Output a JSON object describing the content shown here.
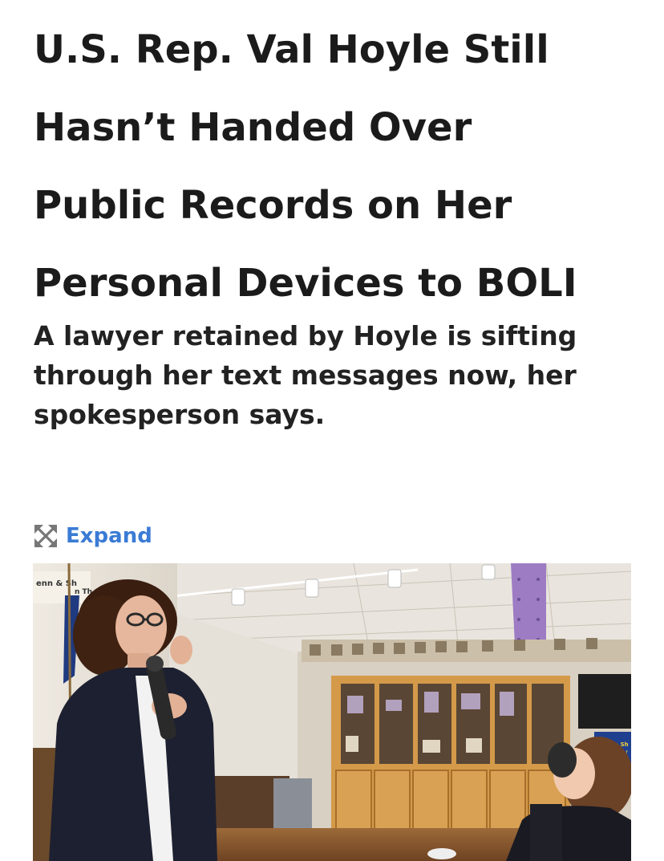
{
  "article": {
    "headline_lines": [
      "U.S. Rep. Val Hoyle Still",
      "Hasn’t Handed Over",
      "Public Records on Her",
      "Personal Devices to BOLI"
    ],
    "dek_lines": [
      "A lawyer retained by Hoyle is sifting",
      "through her text messages now, her",
      "spokesperson says."
    ]
  },
  "media": {
    "expand_label": "Expand",
    "expand_icon": "expand-arrows-icon",
    "accent_color": "#3a7bd5",
    "photo_signs": {
      "left_sign_lines": [
        "enn & Sh",
        "n Th"
      ],
      "right_sign_lines": [
        "Joe Sh",
        "Class of"
      ]
    }
  }
}
